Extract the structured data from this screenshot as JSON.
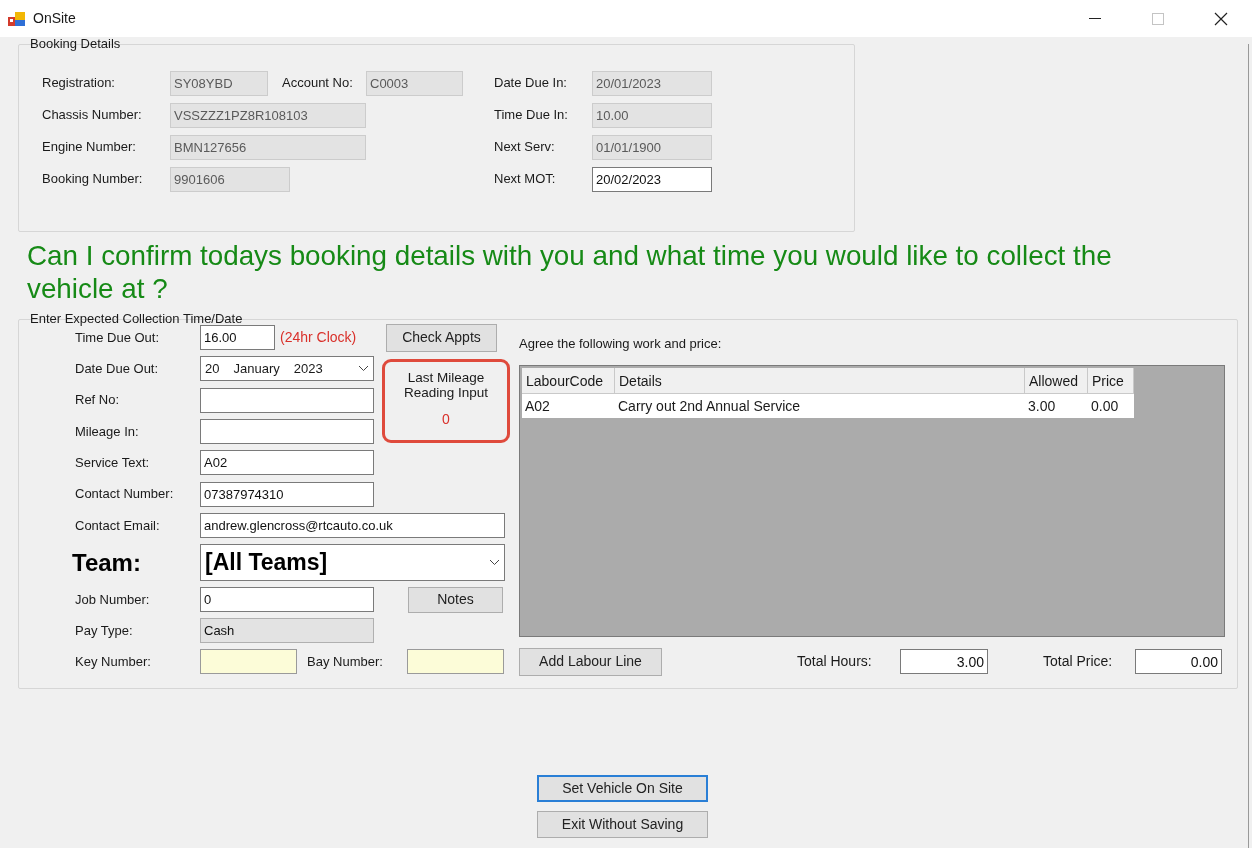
{
  "window": {
    "title": "OnSite"
  },
  "booking_details": {
    "title": "Booking Details",
    "left_rows": [
      [
        {
          "label": "Registration:",
          "value": "SY08YBD",
          "disabled": true
        },
        {
          "label": "Account No:",
          "value": "C0003",
          "disabled": true
        }
      ],
      [
        {
          "label": "Chassis Number:",
          "value": "VSSZZZ1PZ8R108103",
          "disabled": true
        }
      ],
      [
        {
          "label": "Engine Number:",
          "value": "BMN127656",
          "disabled": true
        }
      ],
      [
        {
          "label": "Booking Number:",
          "value": "9901606",
          "disabled": true
        }
      ]
    ],
    "right_fields": [
      {
        "label": "Date Due In:",
        "value": "20/01/2023",
        "disabled": true
      },
      {
        "label": "Time Due In:",
        "value": "10.00",
        "disabled": true
      },
      {
        "label": "Next Serv:",
        "value": "01/01/1900",
        "disabled": true
      },
      {
        "label": "Next MOT:",
        "value": "20/02/2023",
        "disabled": false
      }
    ]
  },
  "question": "Can I confirm todays booking details with you and what time you would like to collect the vehicle at ?",
  "collection": {
    "title": "Enter Expected Collection Time/Date",
    "fields": [
      {
        "kind": "text",
        "label": "Time Due Out:",
        "value": "16.00",
        "hint": "(24hr Clock)"
      },
      {
        "kind": "date",
        "label": "Date Due Out:",
        "parts": [
          "20",
          "January",
          "2023"
        ]
      },
      {
        "kind": "text",
        "label": "Ref No:"
      },
      {
        "kind": "text",
        "label": "Mileage In:"
      },
      {
        "kind": "text",
        "label": "Service Text:",
        "value": "A02"
      },
      {
        "kind": "text",
        "label": "Contact Number:",
        "value": "07387974310"
      },
      {
        "kind": "wide",
        "label": "Contact Email:",
        "value": "andrew.glencross@rtcauto.co.uk"
      },
      {
        "kind": "team",
        "label": "Team:",
        "value": "[All Teams]"
      },
      {
        "kind": "text",
        "label": "Job Number:",
        "value": "0"
      },
      {
        "kind": "readonly",
        "label": "Pay Type:",
        "value": "Cash"
      },
      {
        "kind": "highlight",
        "label": "Key Number:"
      }
    ],
    "check_appts_button": "Check Appts",
    "mileage_box": {
      "caption": "Last Mileage Reading Input",
      "value": "0"
    },
    "notes_button": "Notes",
    "bay_number": {
      "kind": "highlight",
      "label": "Bay Number:"
    }
  },
  "work": {
    "prompt": "Agree the following work and price:",
    "columns": [
      "LabourCode",
      "Details",
      "Allowed",
      "Price"
    ],
    "rows": [
      [
        "A02",
        "Carry out 2nd Annual Service",
        "3.00",
        "0.00"
      ]
    ],
    "add_button": "Add Labour Line",
    "totals": [
      {
        "label": "Total Hours:",
        "value": "3.00"
      },
      {
        "label": "Total Price:",
        "value": "0.00"
      }
    ]
  },
  "actions": [
    {
      "label": "Set Vehicle On Site",
      "focused": true
    },
    {
      "label": "Exit Without Saving",
      "focused": false
    }
  ]
}
